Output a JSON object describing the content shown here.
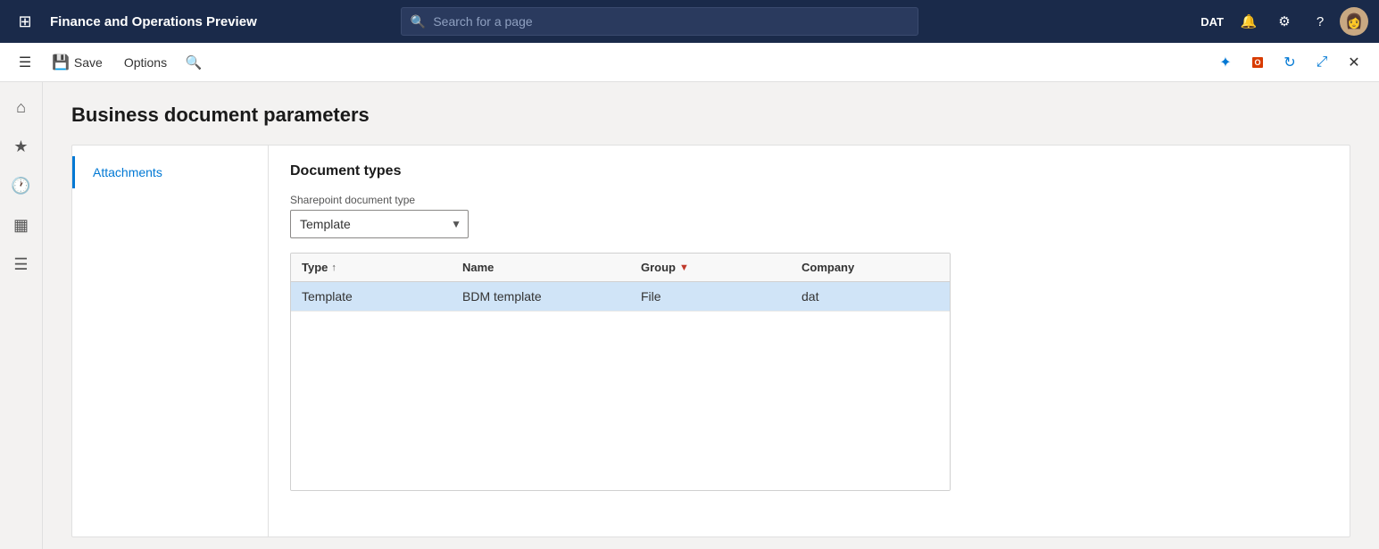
{
  "topNav": {
    "title": "Finance and Operations Preview",
    "search_placeholder": "Search for a page",
    "company_code": "DAT"
  },
  "toolbar": {
    "save_label": "Save",
    "options_label": "Options"
  },
  "page": {
    "title": "Business document parameters"
  },
  "card_nav": {
    "items": [
      {
        "label": "Attachments",
        "active": true
      }
    ]
  },
  "document_types": {
    "section_title": "Document types",
    "field_label": "Sharepoint document type",
    "select_value": "Template",
    "select_options": [
      "Template"
    ]
  },
  "table": {
    "columns": [
      {
        "label": "Type",
        "sortable": true
      },
      {
        "label": "Name",
        "sortable": false
      },
      {
        "label": "Group",
        "filterable": true
      },
      {
        "label": "Company",
        "sortable": false
      }
    ],
    "rows": [
      {
        "type": "Template",
        "name": "BDM template",
        "group": "File",
        "company": "dat"
      }
    ]
  }
}
